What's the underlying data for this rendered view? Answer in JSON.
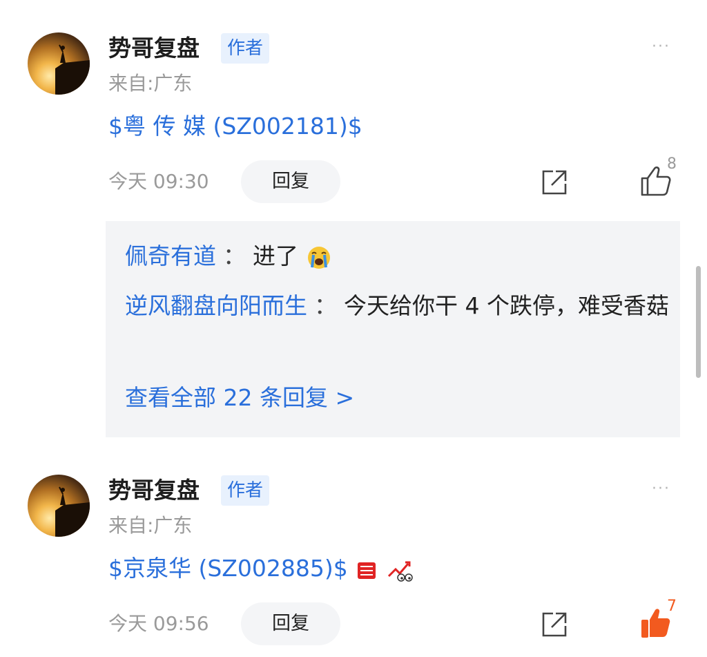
{
  "posts": [
    {
      "author": "势哥复盘",
      "badge": "作者",
      "from": "来自:广东",
      "stock": "$粤 传 媒 (SZ002181)$",
      "time": "今天 09:30",
      "reply_label": "回复",
      "like_count": "8",
      "liked": false
    },
    {
      "author": "势哥复盘",
      "badge": "作者",
      "from": "来自:广东",
      "stock": "$京泉华 (SZ002885)$",
      "time": "今天 09:56",
      "reply_label": "回复",
      "like_count": "7",
      "liked": true
    }
  ],
  "replies": [
    {
      "user": "佩奇有道",
      "colon": "：",
      "text": "进了",
      "emoji": "crying-face-icon"
    },
    {
      "user": "逆风翻盘向阳而生",
      "colon": "：",
      "text": "今天给你干 4 个跌停，难受香菇"
    }
  ],
  "view_all": "查看全部 22 条回复 >",
  "more_icon": "···",
  "colors": {
    "accent": "#2a6fdb",
    "like_active": "#f25a1f",
    "badge_bg": "#e8f1fd",
    "reply_bg": "#f3f4f6"
  }
}
